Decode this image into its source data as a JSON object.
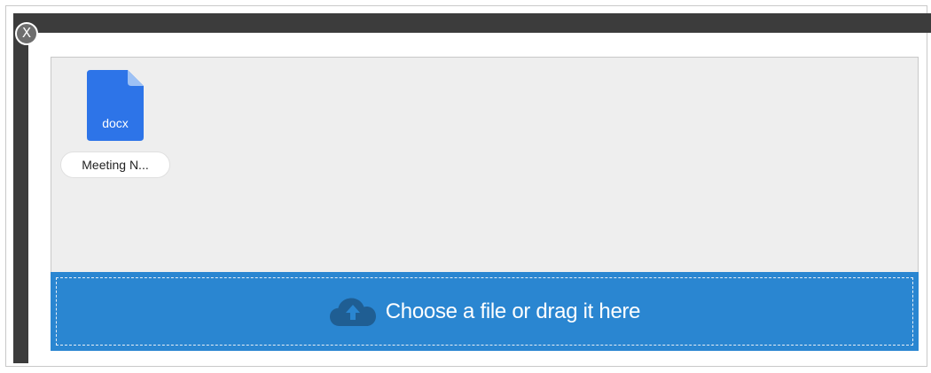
{
  "dialog": {
    "close_label": "X"
  },
  "files": [
    {
      "icon": "docx-file-icon",
      "extension": "docx",
      "name": "Meeting N..."
    }
  ],
  "dropzone": {
    "icon": "cloud-upload-icon",
    "label": "Choose a file or drag it here"
  },
  "colors": {
    "accent": "#2a86d1",
    "file_icon": "#2d74e8",
    "frame_bar": "#3c3c3c",
    "upload_area_bg": "#eeeeee"
  }
}
